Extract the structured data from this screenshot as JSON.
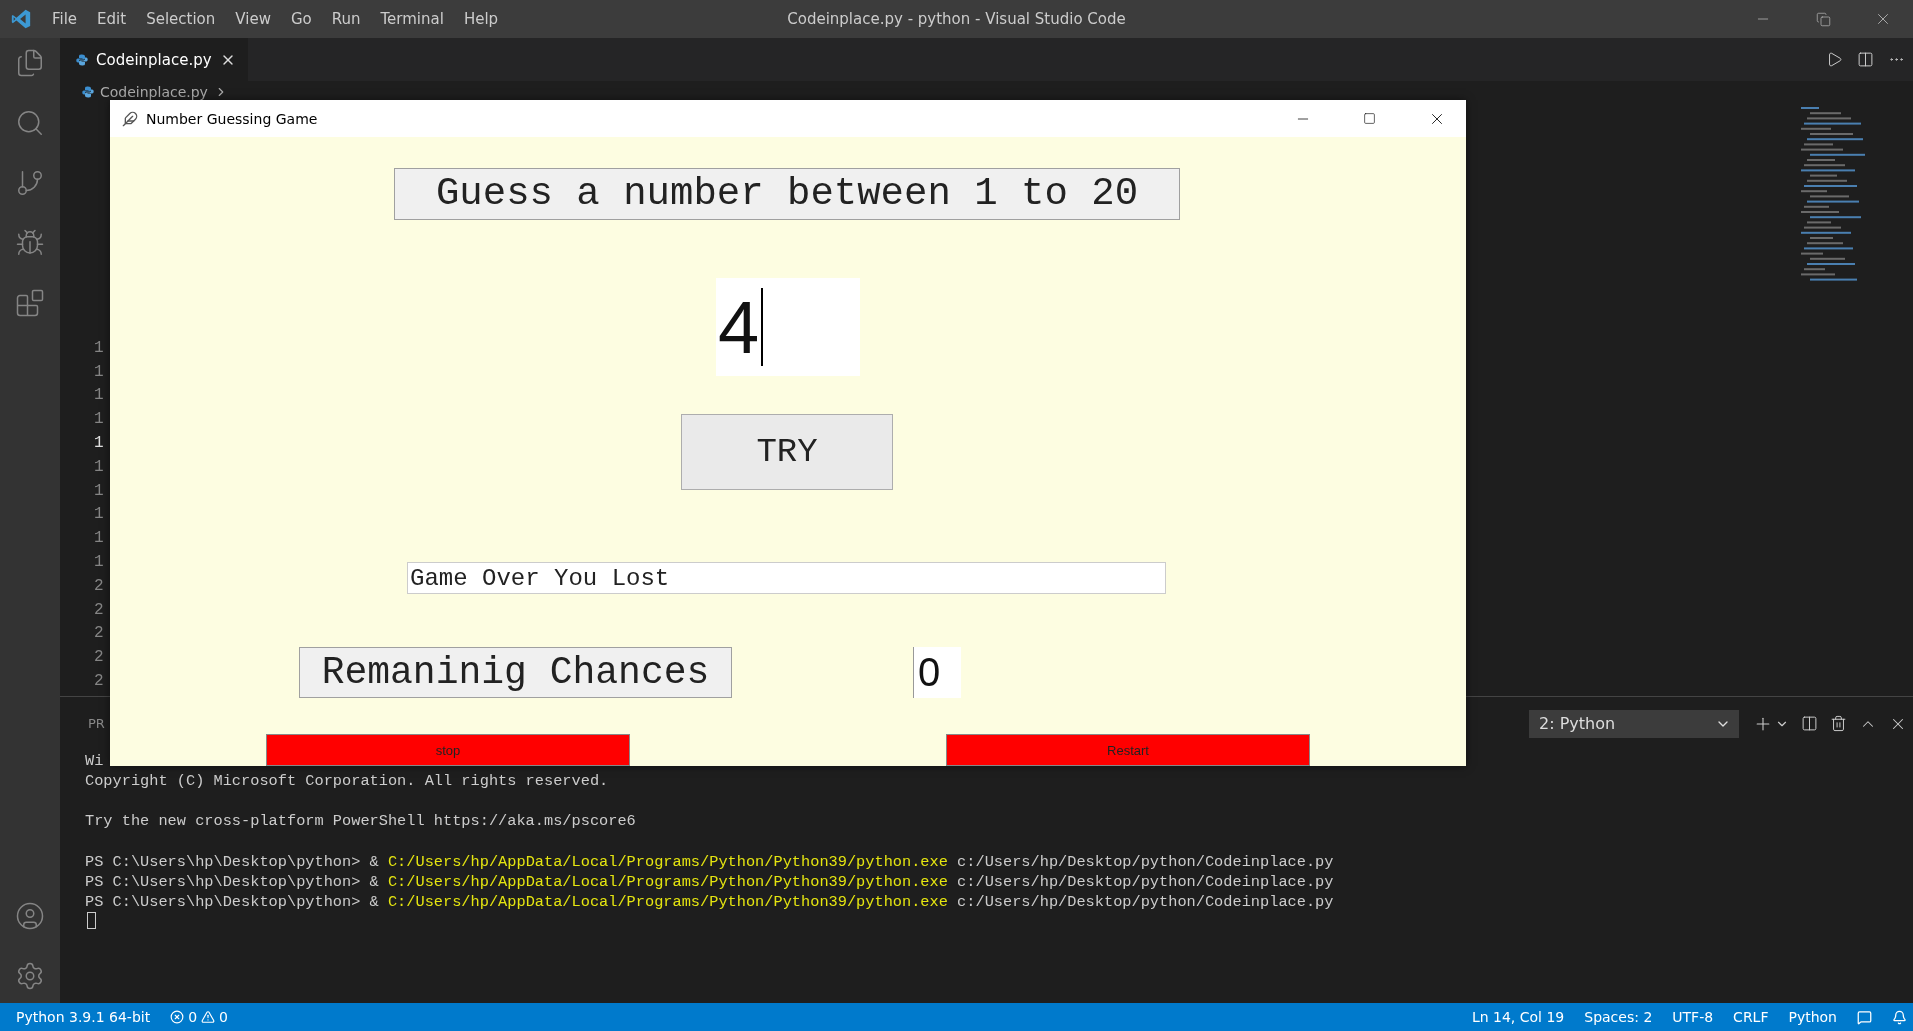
{
  "vscode": {
    "title": "Codeinplace.py - python - Visual Studio Code",
    "menu": [
      "File",
      "Edit",
      "Selection",
      "View",
      "Go",
      "Run",
      "Terminal",
      "Help"
    ],
    "tabs": [
      {
        "label": "Codeinplace.py",
        "selected": true
      }
    ],
    "breadcrumb": "Codeinplace.py",
    "line_numbers": [
      {
        "text": "1",
        "current": false
      },
      {
        "text": "1",
        "current": false
      },
      {
        "text": "1",
        "current": false
      },
      {
        "text": "1",
        "current": false
      },
      {
        "text": "1",
        "current": true
      },
      {
        "text": "1",
        "current": false
      },
      {
        "text": "1",
        "current": false
      },
      {
        "text": "1",
        "current": false
      },
      {
        "text": "1",
        "current": false
      },
      {
        "text": "1",
        "current": false
      },
      {
        "text": "2",
        "current": false
      },
      {
        "text": "2",
        "current": false
      },
      {
        "text": "2",
        "current": false
      },
      {
        "text": "2",
        "current": false
      },
      {
        "text": "2",
        "current": false
      }
    ],
    "panel": {
      "tab": "PR",
      "terminal_select": "2: Python",
      "lines": [
        {
          "kind": "plain",
          "text": "Wi"
        },
        {
          "kind": "plain",
          "text": "Copyright (C) Microsoft Corporation. All rights reserved."
        },
        {
          "kind": "blank"
        },
        {
          "kind": "plain",
          "text": "Try the new cross-platform PowerShell https://aka.ms/pscore6"
        },
        {
          "kind": "blank"
        },
        {
          "kind": "command",
          "prompt": "PS C:\\Users\\hp\\Desktop\\python> &",
          "exe": "C:/Users/hp/AppData/Local/Programs/Python/Python39/python.exe",
          "arg": "c:/Users/hp/Desktop/python/Codeinplace.py"
        },
        {
          "kind": "command",
          "prompt": "PS C:\\Users\\hp\\Desktop\\python> &",
          "exe": "C:/Users/hp/AppData/Local/Programs/Python/Python39/python.exe",
          "arg": "c:/Users/hp/Desktop/python/Codeinplace.py"
        },
        {
          "kind": "command",
          "prompt": "PS C:\\Users\\hp\\Desktop\\python> &",
          "exe": "C:/Users/hp/AppData/Local/Programs/Python/Python39/python.exe",
          "arg": "c:/Users/hp/Desktop/python/Codeinplace.py"
        },
        {
          "kind": "cursor"
        }
      ]
    },
    "status_bar": {
      "interpreter": "Python 3.9.1 64-bit",
      "errors": "0",
      "warnings": "0",
      "right": [
        "Ln 14, Col 19",
        "Spaces: 2",
        "UTF-8",
        "CRLF",
        "Python"
      ]
    }
  },
  "game_window": {
    "title": "Number Guessing Game",
    "prompt": "Guess a number between 1 to 20",
    "guess_input": {
      "value": "4"
    },
    "try_button": "TRY",
    "result": {
      "value": "Game Over You Lost"
    },
    "chances_label": "Remaninig Chances",
    "chances_value": "0",
    "buttons": [
      {
        "label": "stop"
      },
      {
        "label": "Restart"
      }
    ]
  }
}
